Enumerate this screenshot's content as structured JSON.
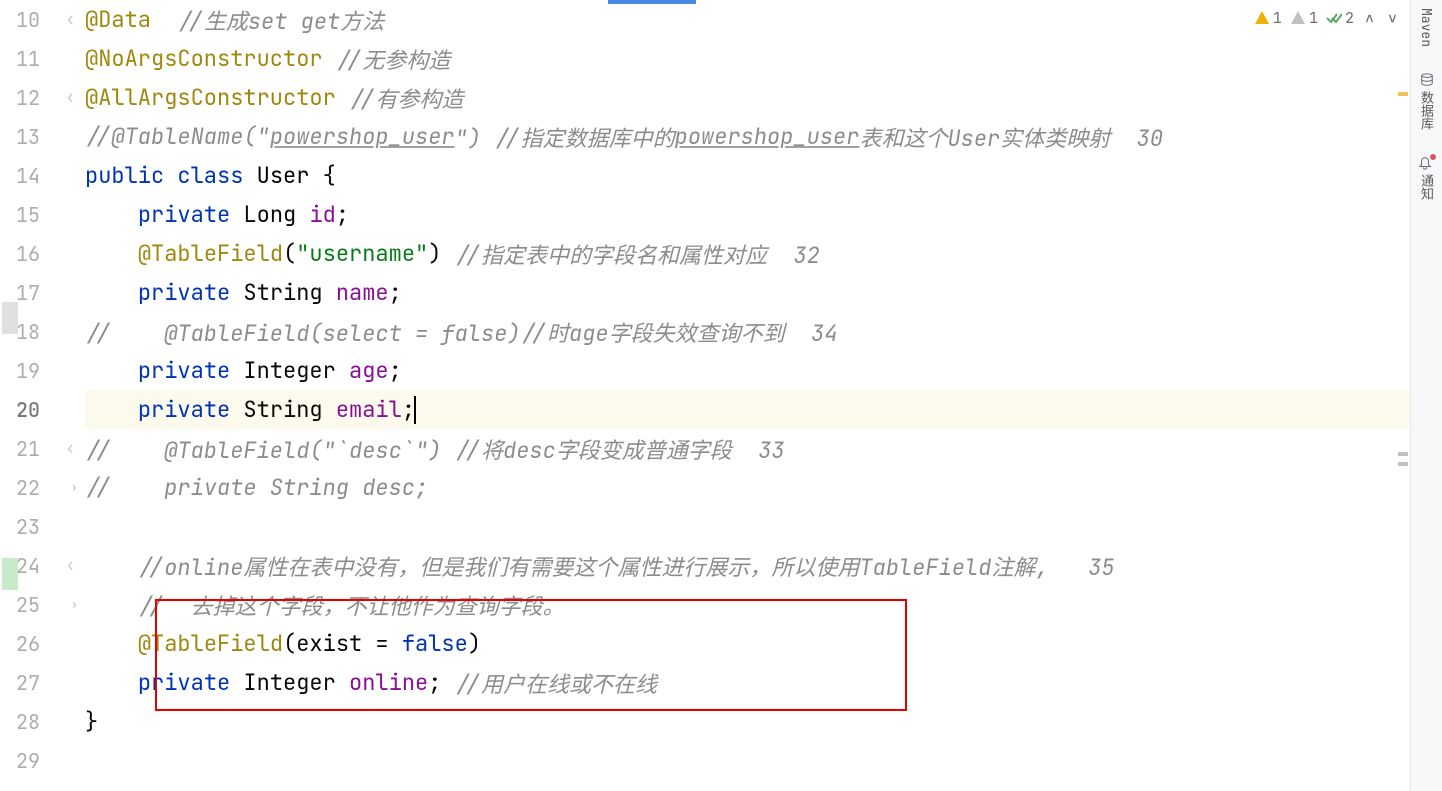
{
  "lines": {
    "start": 10,
    "current": 20,
    "end": 29
  },
  "code": {
    "l10_anno": "@Data",
    "l10_cmt": "  //生成set get方法",
    "l11_anno": "@NoArgsConstructor",
    "l11_cmt": " //无参构造",
    "l12_anno": "@AllArgsConstructor",
    "l12_cmt": " //有参构造",
    "l13_cmt1": "//@TableName(\"",
    "l13_cmt_u": "powershop_user",
    "l13_cmt2": "\") //指定数据库中的",
    "l13_cmt_u2": "powershop_user",
    "l13_cmt3": "表和这个User实体类映射  30",
    "l14_kw1": "public",
    "l14_kw2": "class",
    "l14_type": "User",
    "l14_brace": " {",
    "l15_kw": "private",
    "l15_type": "Long",
    "l15_field": "id",
    "l16_anno": "@TableField",
    "l16_paren": "(",
    "l16_str": "\"username\"",
    "l16_paren2": ")",
    "l16_cmt": " //指定表中的字段名和属性对应  32",
    "l17_kw": "private",
    "l17_type": "String",
    "l17_field": "name",
    "l18_cmt": "//    @TableField(select = false)//时age字段失效查询不到  34",
    "l19_kw": "private",
    "l19_type": "Integer",
    "l19_field": "age",
    "l20_kw": "private",
    "l20_type": "String",
    "l20_field": "email",
    "l21_cmt": "//    @TableField(\"`desc`\") //将desc字段变成普通字段  33",
    "l22_cmt": "//    private String desc;",
    "l24_cmt": "//online属性在表中没有，但是我们有需要这个属性进行展示，所以使用TableField注解,   35",
    "l25_cmt": "//  去掉这个字段，不让他作为查询字段。",
    "l26_anno": "@TableField",
    "l26_paren": "(exist = ",
    "l26_kw": "false",
    "l26_paren2": ")",
    "l27_kw": "private",
    "l27_type": "Integer",
    "l27_field": "online",
    "l27_cmt": " //用户在线或不在线",
    "l28_brace": "}"
  },
  "inspections": {
    "warn1": "1",
    "warn2": "1",
    "check": "2"
  },
  "sidebar": {
    "maven": "Maven",
    "database": "数据库",
    "notif": "通知"
  }
}
